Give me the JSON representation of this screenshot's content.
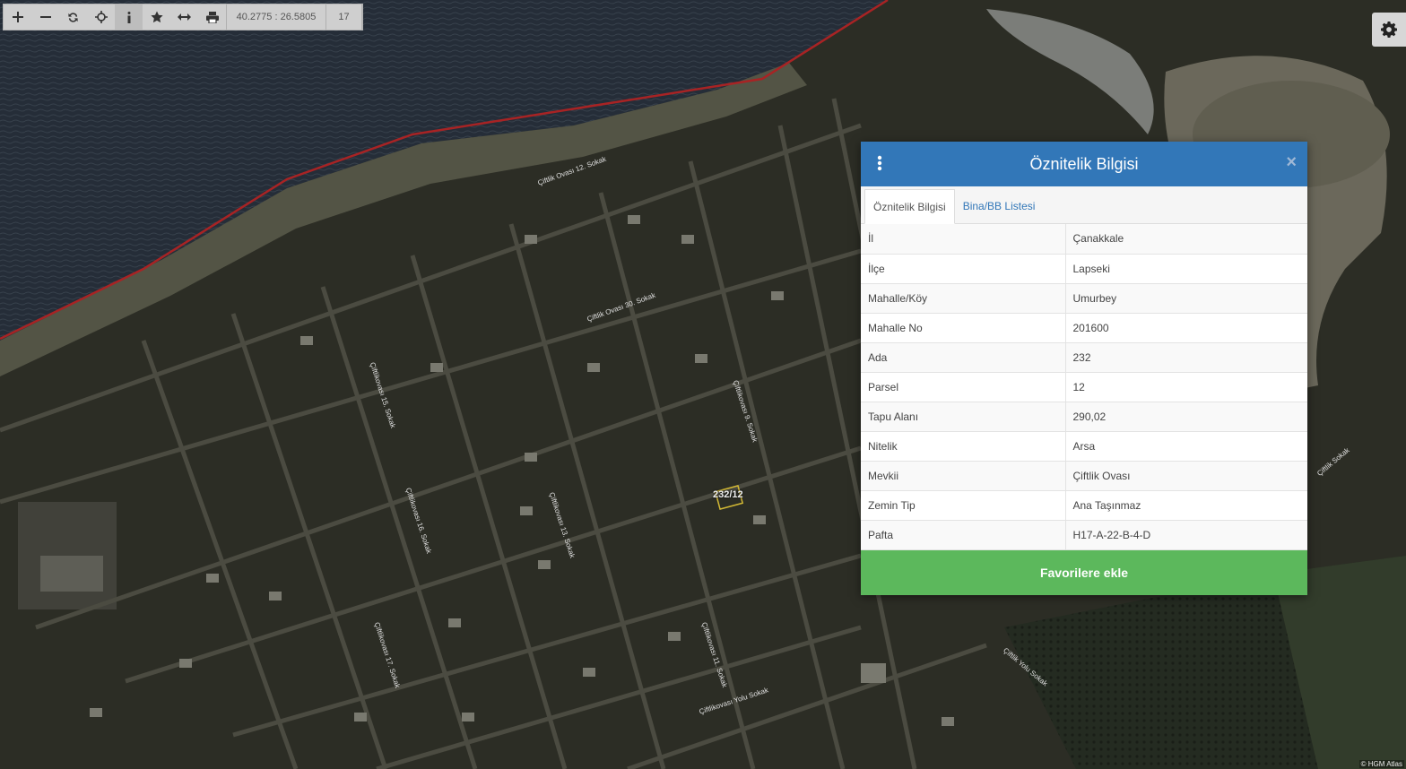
{
  "toolbar": {
    "coordinates": "40.2775 : 26.5805",
    "zoom": "17",
    "buttons": [
      {
        "name": "zoom-in",
        "icon": "plus-icon"
      },
      {
        "name": "zoom-out",
        "icon": "minus-icon"
      },
      {
        "name": "refresh",
        "icon": "refresh-icon"
      },
      {
        "name": "locate",
        "icon": "crosshair-icon"
      },
      {
        "name": "info",
        "icon": "info-icon"
      },
      {
        "name": "favorites",
        "icon": "star-icon"
      },
      {
        "name": "measure",
        "icon": "arrows-horizontal-icon"
      },
      {
        "name": "print",
        "icon": "print-icon"
      }
    ]
  },
  "map": {
    "parcel_label": "232/12",
    "attribution": "© HGM Atlas",
    "street_labels": [
      "Çiftlik Ovası 12. Sokak",
      "Çiftlik Ovası 30. Sokak",
      "Çiftlikovası 15. Sokak",
      "Çiftlikovası 16. Sokak",
      "Çiftlikovası 17. Sokak",
      "Çiftlikovası 13. Sokak",
      "Çiftlikovası 11. Sokak",
      "Çiftlikovası 9. Sokak",
      "Çiftlikovası Yolu Sokak",
      "Çiftlik Yolu Sokak",
      "Çiftlik Sokak"
    ]
  },
  "panel": {
    "title": "Öznitelik Bilgisi",
    "tabs": [
      {
        "label": "Öznitelik Bilgisi",
        "active": true
      },
      {
        "label": "Bina/BB Listesi",
        "active": false
      }
    ],
    "rows": [
      {
        "key": "İl",
        "value": "Çanakkale"
      },
      {
        "key": "İlçe",
        "value": "Lapseki"
      },
      {
        "key": "Mahalle/Köy",
        "value": "Umurbey"
      },
      {
        "key": "Mahalle No",
        "value": "201600"
      },
      {
        "key": "Ada",
        "value": "232"
      },
      {
        "key": "Parsel",
        "value": "12"
      },
      {
        "key": "Tapu Alanı",
        "value": "290,02"
      },
      {
        "key": "Nitelik",
        "value": "Arsa"
      },
      {
        "key": "Mevkii",
        "value": "Çiftlik Ovası"
      },
      {
        "key": "Zemin Tip",
        "value": "Ana Taşınmaz"
      },
      {
        "key": "Pafta",
        "value": "H17-A-22-B-4-D"
      }
    ],
    "favorite_button": "Favorilere ekle"
  },
  "colors": {
    "header": "#3277b8",
    "favorite": "#5cb85c",
    "boundary_line": "#c0282a",
    "parcel_highlight": "#f0d23c"
  }
}
